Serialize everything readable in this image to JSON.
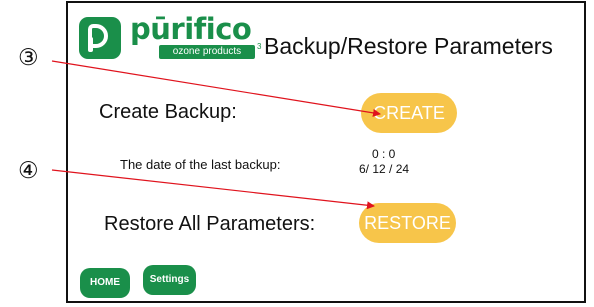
{
  "brand": {
    "name": "pūrifico",
    "tagline": "ozone products",
    "subscript": "3",
    "color": "#1a8f4a"
  },
  "header": {
    "title": "Backup/Restore Parameters"
  },
  "backup": {
    "label": "Create Backup:",
    "button_label": "CREATE"
  },
  "last_backup": {
    "label": "The date of the last backup:",
    "time": "0 : 0",
    "date": "6/ 12 / 24"
  },
  "restore": {
    "label": "Restore All Parameters:",
    "button_label": "RESTORE"
  },
  "nav": {
    "home_label": "HOME",
    "settings_label": "Settings"
  },
  "annotations": {
    "callout_3": "③",
    "callout_4": "④",
    "arrow_color": "#e0131d"
  },
  "colors": {
    "action_button": "#f7c54a",
    "nav_button": "#1a8f4a"
  }
}
